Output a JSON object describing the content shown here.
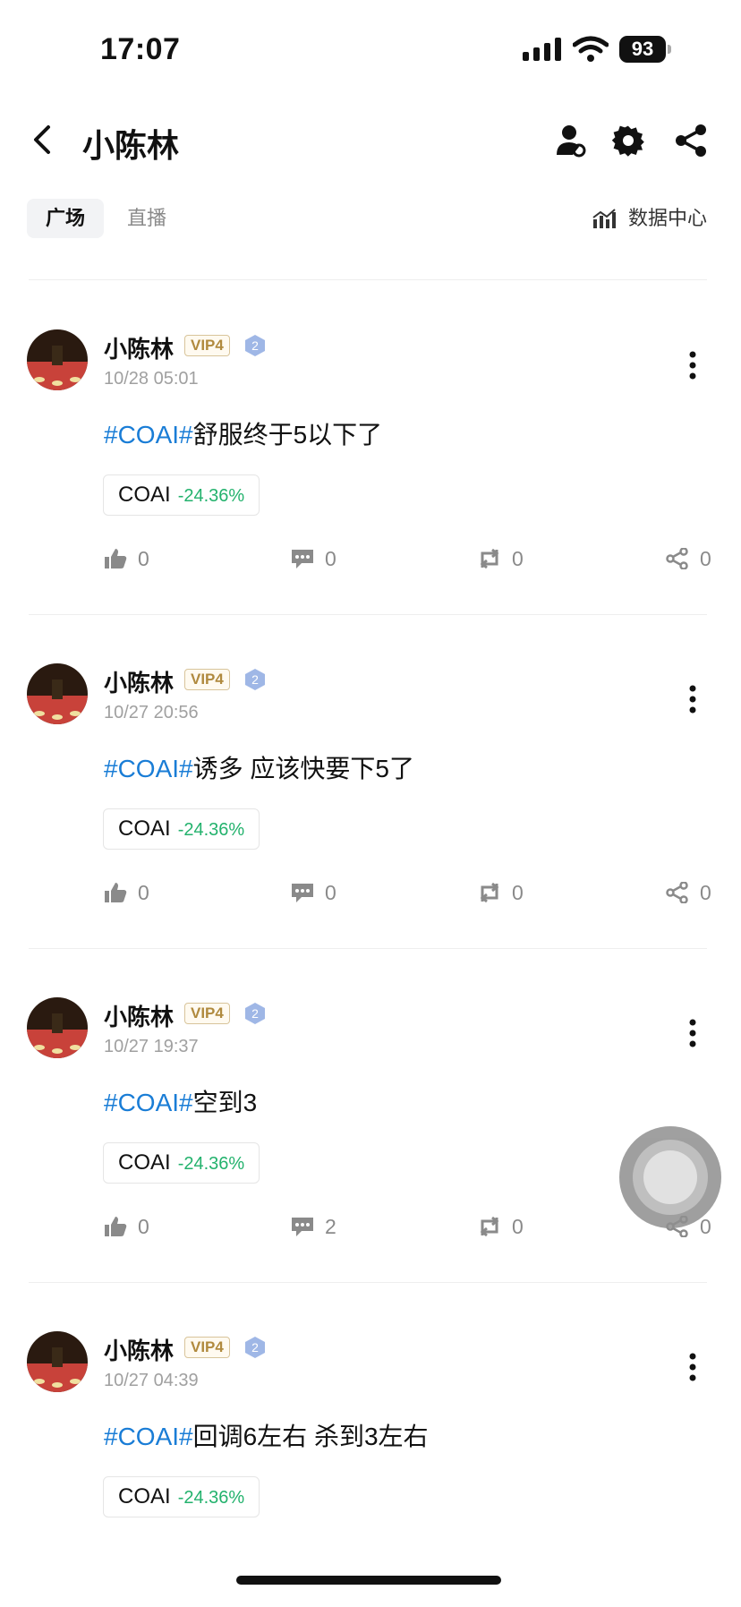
{
  "status_bar": {
    "time": "17:07",
    "battery": "93"
  },
  "header": {
    "title": "小陈林"
  },
  "tabs": {
    "active": "广场",
    "other": "直播",
    "data_center": "数据中心"
  },
  "posts": [
    {
      "author": "小陈林",
      "vip": "VIP4",
      "level": "2",
      "time": "10/28 05:01",
      "hashtag": "#COAI#",
      "text": "舒服终于5以下了",
      "chip_symbol": "COAI",
      "chip_change": "-24.36%",
      "likes": "0",
      "comments": "0",
      "reposts": "0",
      "shares": "0"
    },
    {
      "author": "小陈林",
      "vip": "VIP4",
      "level": "2",
      "time": "10/27 20:56",
      "hashtag": "#COAI#",
      "text": "诱多 应该快要下5了",
      "chip_symbol": "COAI",
      "chip_change": "-24.36%",
      "likes": "0",
      "comments": "0",
      "reposts": "0",
      "shares": "0"
    },
    {
      "author": "小陈林",
      "vip": "VIP4",
      "level": "2",
      "time": "10/27 19:37",
      "hashtag": "#COAI#",
      "text": "空到3",
      "chip_symbol": "COAI",
      "chip_change": "-24.36%",
      "likes": "0",
      "comments": "2",
      "reposts": "0",
      "shares": "0"
    },
    {
      "author": "小陈林",
      "vip": "VIP4",
      "level": "2",
      "time": "10/27 04:39",
      "hashtag": "#COAI#",
      "text": "回调6左右 杀到3左右",
      "chip_symbol": "COAI",
      "chip_change": "-24.36%"
    }
  ],
  "colors": {
    "hashtag": "#1a7dd6",
    "change_down": "#23b26d",
    "vip_gold": "#b08a3e"
  },
  "icons": [
    "back-icon",
    "user-icon",
    "gear-icon",
    "share-icon",
    "chart-icon",
    "more-icon",
    "like-icon",
    "comment-icon",
    "repost-icon",
    "share-icon"
  ]
}
